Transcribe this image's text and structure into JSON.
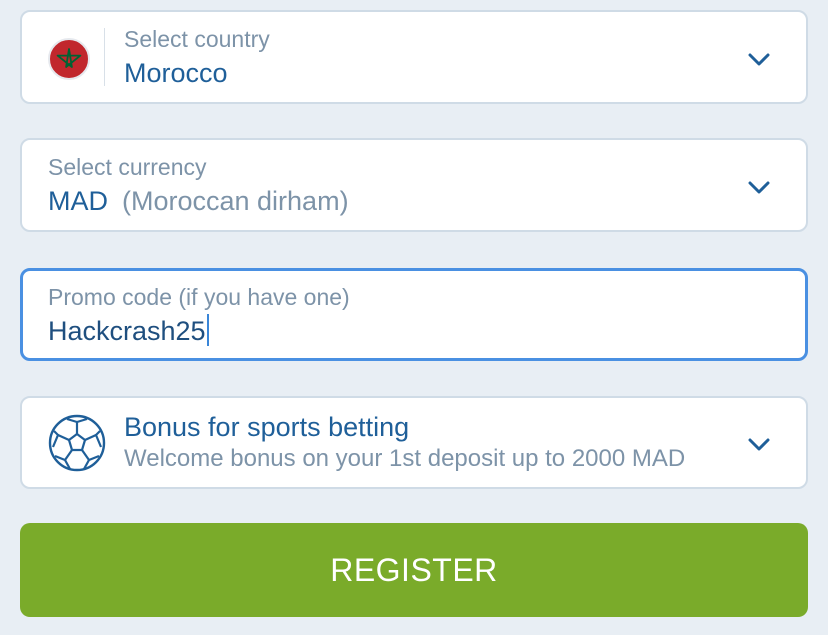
{
  "country": {
    "label": "Select country",
    "value": "Morocco",
    "flag_icon": "morocco-flag-icon",
    "flag_colors": {
      "red": "#c1272d",
      "green": "#006233"
    }
  },
  "currency": {
    "label": "Select currency",
    "code": "MAD",
    "name": "(Moroccan dirham)"
  },
  "promo": {
    "label": "Promo code (if you have one)",
    "value": "Hackcrash25"
  },
  "bonus": {
    "icon": "soccer-ball-icon",
    "title": "Bonus for sports betting",
    "subtitle": "Welcome bonus on your 1st deposit up to 2000 MAD"
  },
  "register": {
    "label": "REGISTER"
  },
  "colors": {
    "background": "#e8eef4",
    "accent": "#1f5f99",
    "muted": "#7d93a8",
    "focus_border": "#4a90e2",
    "register_button": "#7aab2a"
  }
}
